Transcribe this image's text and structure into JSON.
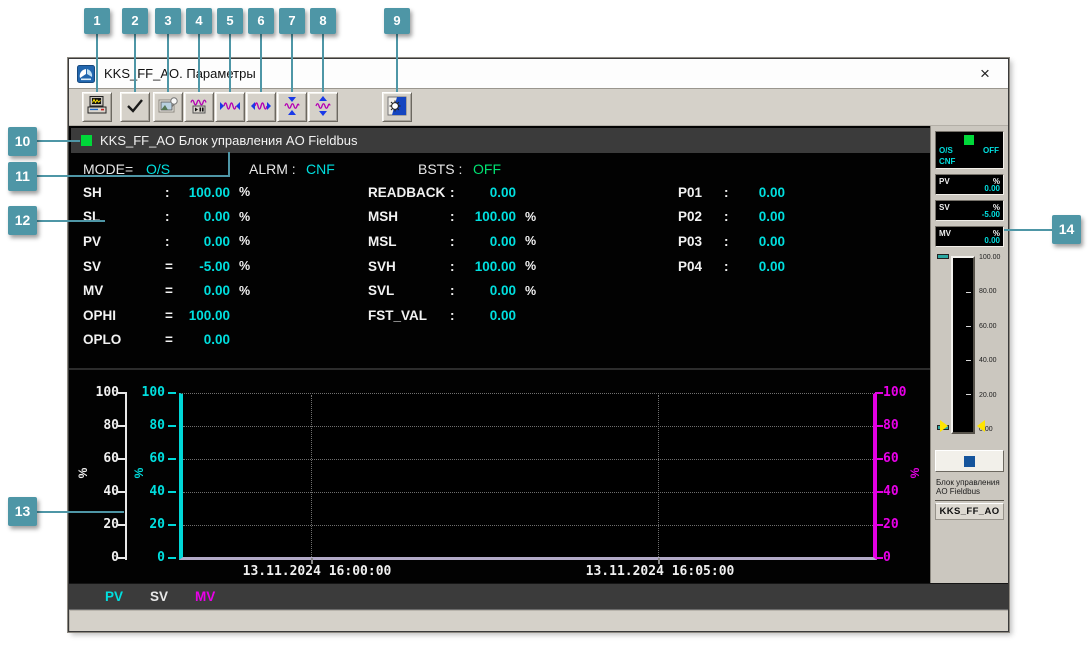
{
  "window": {
    "title": "KKS_FF_AO. Параметры",
    "close": "×"
  },
  "callouts": [
    "1",
    "2",
    "3",
    "4",
    "5",
    "6",
    "7",
    "8",
    "9",
    "10",
    "11",
    "12",
    "13",
    "14"
  ],
  "toolbar": {
    "buttons": [
      {
        "icon": "screen-print-icon"
      },
      {
        "icon": "apply-check-icon"
      },
      {
        "icon": "snapshot-icon"
      },
      {
        "icon": "trend-pause-icon"
      },
      {
        "icon": "trend-compress-horizontal-icon"
      },
      {
        "icon": "trend-expand-horizontal-icon"
      },
      {
        "icon": "trend-compress-vertical-icon"
      },
      {
        "icon": "trend-expand-vertical-icon"
      },
      {
        "icon": "theme-toggle-icon"
      }
    ]
  },
  "tag_header": {
    "title": "KKS_FF_AO Блок управления AO Fieldbus"
  },
  "status_row": {
    "mode_label": "MODE=",
    "mode_value": "O/S",
    "alrm_label": "ALRM :",
    "alrm_value": "CNF",
    "bsts_label": "BSTS :",
    "bsts_value": "OFF"
  },
  "parameters": {
    "col1": [
      {
        "label": "SH",
        "sep": ":",
        "value": "100.00",
        "unit": "%"
      },
      {
        "label": "SL",
        "sep": ":",
        "value": "0.00",
        "unit": "%"
      },
      {
        "label": "PV",
        "sep": ":",
        "value": "0.00",
        "unit": "%"
      },
      {
        "label": "SV",
        "sep": "=",
        "value": "-5.00",
        "unit": "%"
      },
      {
        "label": "MV",
        "sep": "=",
        "value": "0.00",
        "unit": "%"
      },
      {
        "label": "OPHI",
        "sep": "=",
        "value": "100.00",
        "unit": ""
      },
      {
        "label": "OPLO",
        "sep": "=",
        "value": "0.00",
        "unit": ""
      }
    ],
    "col2": [
      {
        "label": "READBACK",
        "sep": ":",
        "value": "0.00",
        "unit": ""
      },
      {
        "label": "MSH",
        "sep": ":",
        "value": "100.00",
        "unit": "%"
      },
      {
        "label": "MSL",
        "sep": ":",
        "value": "0.00",
        "unit": "%"
      },
      {
        "label": "SVH",
        "sep": ":",
        "value": "100.00",
        "unit": "%"
      },
      {
        "label": "SVL",
        "sep": ":",
        "value": "0.00",
        "unit": "%"
      },
      {
        "label": "FST_VAL",
        "sep": ":",
        "value": "0.00",
        "unit": ""
      }
    ],
    "col3": [
      {
        "label": "P01",
        "sep": ":",
        "value": "0.00"
      },
      {
        "label": "P02",
        "sep": ":",
        "value": "0.00"
      },
      {
        "label": "P03",
        "sep": ":",
        "value": "0.00"
      },
      {
        "label": "P04",
        "sep": ":",
        "value": "0.00"
      }
    ]
  },
  "chart_data": {
    "type": "line",
    "title": "",
    "x_ticks": [
      "13.11.2024 16:00:00",
      "13.11.2024 16:05:00"
    ],
    "axes": [
      {
        "side": "left-outer",
        "series": "SV",
        "label": "%",
        "color": "#f0f0f0",
        "ticks": [
          "100",
          "80",
          "60",
          "40",
          "20",
          "0"
        ],
        "range": [
          0,
          100
        ]
      },
      {
        "side": "left-inner",
        "series": "PV",
        "label": "%",
        "color": "#00dfdf",
        "ticks": [
          "100",
          "80",
          "60",
          "40",
          "20",
          "0"
        ],
        "range": [
          0,
          100
        ]
      },
      {
        "side": "right",
        "series": "MV",
        "label": "%",
        "color": "#e800e8",
        "ticks": [
          "100",
          "80",
          "60",
          "40",
          "20",
          "0"
        ],
        "range": [
          0,
          100
        ]
      }
    ],
    "series": [
      {
        "name": "PV",
        "color": "#00dfdf",
        "values": []
      },
      {
        "name": "SV",
        "color": "#e8e8e8",
        "values": []
      },
      {
        "name": "MV",
        "color": "#e800e8",
        "values": []
      }
    ],
    "grid": true,
    "legend_position": "bottom",
    "note": "trend window is empty - no visible data traces"
  },
  "legend": {
    "items": [
      {
        "label": "PV",
        "color": "#00dfdf"
      },
      {
        "label": "SV",
        "color": "#e8e8e8"
      },
      {
        "label": "MV",
        "color": "#e800e8"
      }
    ]
  },
  "faceplate": {
    "status": {
      "mode": "O/S",
      "state": "OFF",
      "alarm": "CNF"
    },
    "values": [
      {
        "label": "PV",
        "unit": "%",
        "value": "0.00"
      },
      {
        "label": "SV",
        "unit": "%",
        "value": "-5.00"
      },
      {
        "label": "MV",
        "unit": "%",
        "value": "0.00"
      }
    ],
    "gauge": {
      "scale": [
        "100.00",
        "80.00",
        "60.00",
        "40.00",
        "20.00",
        "0.00"
      ],
      "range": [
        0,
        100
      ]
    },
    "description": "Блок управления AO Fieldbus",
    "tag": "KKS_FF_AO"
  },
  "colors": {
    "badge": "#4e96a6",
    "cyan": "#00dfdf",
    "green": "#00d839",
    "green_text": "#00e473",
    "magenta": "#e800e8",
    "panel_dark": "#3b3b3b",
    "window_chrome": "#d5d1c9"
  }
}
